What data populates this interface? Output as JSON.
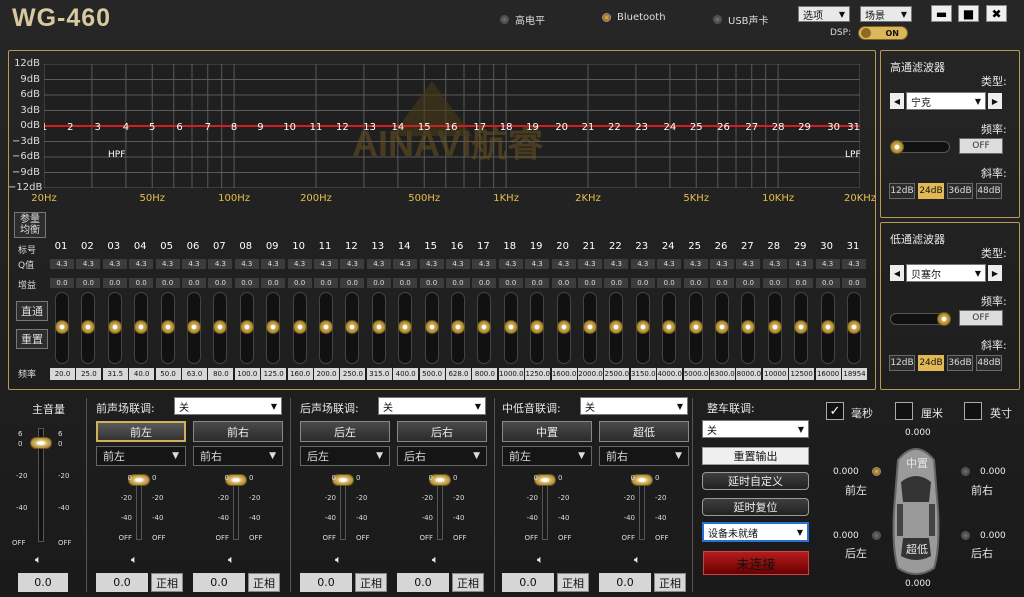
{
  "app": {
    "title": "WG-460"
  },
  "status": {
    "items": [
      {
        "label": "高电平",
        "on": false
      },
      {
        "label": "Bluetooth",
        "on": true
      },
      {
        "label": "USB声卡",
        "on": false
      }
    ],
    "dsp_label": "DSP:",
    "dsp_state": "ON"
  },
  "menu": {
    "options": "选项",
    "scene": "场景"
  },
  "window": {
    "min": "▬",
    "max": "■",
    "close": "✖"
  },
  "graph": {
    "y_labels": [
      "12dB",
      "9dB",
      "6dB",
      "3dB",
      "0dB",
      "−3dB",
      "−6dB",
      "−9dB",
      "−12dB"
    ],
    "x_labels": [
      "20Hz",
      "50Hz",
      "100Hz",
      "200Hz",
      "500Hz",
      "1KHz",
      "2KHz",
      "5KHz",
      "10KHz",
      "20KHz"
    ],
    "hpf": "HPF",
    "lpf": "LPF",
    "watermark": "AINAVI航睿",
    "band_numbers": [
      "1",
      "2",
      "3",
      "4",
      "5",
      "6",
      "7",
      "8",
      "9",
      "10",
      "11",
      "12",
      "13",
      "14",
      "15",
      "16",
      "17",
      "18",
      "19",
      "20",
      "21",
      "22",
      "23",
      "24",
      "25",
      "26",
      "27",
      "28",
      "29",
      "30",
      "31"
    ]
  },
  "eq": {
    "param_btn": "参量均衡",
    "row_labels": {
      "id": "标号",
      "q": "Q值",
      "gain": "增益",
      "freq": "频率"
    },
    "ids": [
      "01",
      "02",
      "03",
      "04",
      "05",
      "06",
      "07",
      "08",
      "09",
      "10",
      "11",
      "12",
      "13",
      "14",
      "15",
      "16",
      "17",
      "18",
      "19",
      "20",
      "21",
      "22",
      "23",
      "24",
      "25",
      "26",
      "27",
      "28",
      "29",
      "30",
      "31"
    ],
    "q": [
      "4.3",
      "4.3",
      "4.3",
      "4.3",
      "4.3",
      "4.3",
      "4.3",
      "4.3",
      "4.3",
      "4.3",
      "4.3",
      "4.3",
      "4.3",
      "4.3",
      "4.3",
      "4.3",
      "4.3",
      "4.3",
      "4.3",
      "4.3",
      "4.3",
      "4.3",
      "4.3",
      "4.3",
      "4.3",
      "4.3",
      "4.3",
      "4.3",
      "4.3",
      "4.3",
      "4.3"
    ],
    "gain": [
      "0.0",
      "0.0",
      "0.0",
      "0.0",
      "0.0",
      "0.0",
      "0.0",
      "0.0",
      "0.0",
      "0.0",
      "0.0",
      "0.0",
      "0.0",
      "0.0",
      "0.0",
      "0.0",
      "0.0",
      "0.0",
      "0.0",
      "0.0",
      "0.0",
      "0.0",
      "0.0",
      "0.0",
      "0.0",
      "0.0",
      "0.0",
      "0.0",
      "0.0",
      "0.0",
      "0.0"
    ],
    "freqs": [
      "20.0",
      "25.0",
      "31.5",
      "40.0",
      "50.0",
      "63.0",
      "80.0",
      "100.0",
      "125.0",
      "160.0",
      "200.0",
      "250.0",
      "315.0",
      "400.0",
      "500.0",
      "628.0",
      "800.0",
      "1000.0",
      "1250.0",
      "1600.0",
      "2000.0",
      "2500.0",
      "3150.0",
      "4000.0",
      "5000.0",
      "6300.0",
      "8000.0",
      "10000",
      "12500",
      "16000",
      "18954"
    ],
    "bypass": "直通",
    "reset": "重置"
  },
  "hp_filter": {
    "title": "高通滤波器",
    "type_label": "类型:",
    "type_value": "宁克",
    "freq_label": "频率:",
    "freq_state": "OFF",
    "slope_label": "斜率:",
    "slopes": [
      "12dB",
      "24dB",
      "36dB",
      "48dB"
    ],
    "selected": "24dB"
  },
  "lp_filter": {
    "title": "低通滤波器",
    "type_label": "类型:",
    "type_value": "贝塞尔",
    "freq_label": "频率:",
    "freq_state": "OFF",
    "slope_label": "斜率:",
    "slopes": [
      "12dB",
      "24dB",
      "36dB",
      "48dB"
    ],
    "selected": "24dB"
  },
  "master": {
    "label": "主音量",
    "value": "0.0",
    "scale": [
      "6",
      "0",
      "-20",
      "-40",
      "OFF"
    ],
    "scale_r": [
      "6",
      "0",
      "-20",
      "-40",
      "OFF"
    ]
  },
  "groups": [
    {
      "label": "前声场联调:",
      "value": "关",
      "ch": [
        {
          "tab": "前左",
          "sel": "前左",
          "val": "0.0",
          "phase": "正相",
          "selected": true
        },
        {
          "tab": "前右",
          "sel": "前右",
          "val": "0.0",
          "phase": "正相",
          "selected": false
        }
      ]
    },
    {
      "label": "后声场联调:",
      "value": "关",
      "ch": [
        {
          "tab": "后左",
          "sel": "后左",
          "val": "0.0",
          "phase": "正相",
          "selected": false
        },
        {
          "tab": "后右",
          "sel": "后右",
          "val": "0.0",
          "phase": "正相",
          "selected": false
        }
      ]
    },
    {
      "label": "中低音联调:",
      "value": "关",
      "ch": [
        {
          "tab": "中置",
          "sel": "前左",
          "val": "0.0",
          "phase": "正相",
          "selected": false
        },
        {
          "tab": "超低",
          "sel": "前右",
          "val": "0.0",
          "phase": "正相",
          "selected": false
        }
      ]
    }
  ],
  "fader_scale": [
    "0",
    "-20",
    "-40",
    "OFF"
  ],
  "car": {
    "label": "整车联调:",
    "value": "关",
    "reset_out": "重置输出",
    "delay_custom": "延时自定义",
    "delay_reset": "延时复位",
    "device": "设备未就绪",
    "connect": "未连接"
  },
  "units": {
    "ms": "毫秒",
    "cm": "厘米",
    "inch": "英寸"
  },
  "seat": {
    "top": "0.000",
    "bottom": "0.000",
    "fl_val": "0.000",
    "fl": "前左",
    "fr_val": "0.000",
    "fr": "前右",
    "rl_val": "0.000",
    "rl": "后左",
    "rr_val": "0.000",
    "rr": "后右",
    "center": "中置",
    "sub": "超低"
  }
}
